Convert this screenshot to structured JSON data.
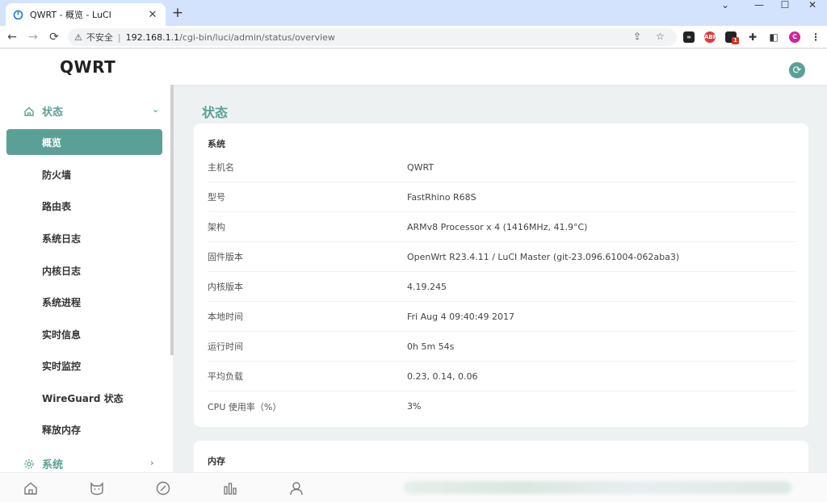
{
  "browser": {
    "tab_title": "QWRT - 概览 - LuCI",
    "insecure_label": "不安全",
    "url_host": "192.168.1.1",
    "url_path": "/cgi-bin/luci/admin/status/overview",
    "extension_badge": "1",
    "profile_initial": "C"
  },
  "app": {
    "brand": "QWRT",
    "accent_color": "#5ba096"
  },
  "sidebar": {
    "groups": [
      {
        "label": "状态",
        "icon": "home-icon",
        "expanded": true
      },
      {
        "label": "系统",
        "icon": "gear-icon",
        "expanded": false
      }
    ],
    "items": [
      {
        "label": "概览",
        "active": true
      },
      {
        "label": "防火墙"
      },
      {
        "label": "路由表"
      },
      {
        "label": "系统日志"
      },
      {
        "label": "内核日志"
      },
      {
        "label": "系统进程"
      },
      {
        "label": "实时信息"
      },
      {
        "label": "实时监控"
      },
      {
        "label": "WireGuard 状态"
      },
      {
        "label": "释放内存"
      }
    ]
  },
  "main": {
    "page_title": "状态",
    "system_card": {
      "title": "系统",
      "rows": [
        {
          "key": "主机名",
          "value": "QWRT"
        },
        {
          "key": "型号",
          "value": "FastRhino R68S"
        },
        {
          "key": "架构",
          "value": "ARMv8 Processor x 4 (1416MHz, 41.9°C)"
        },
        {
          "key": "固件版本",
          "value": "OpenWrt R23.4.11 / LuCI Master (git-23.096.61004-062aba3)"
        },
        {
          "key": "内核版本",
          "value": "4.19.245"
        },
        {
          "key": "本地时间",
          "value": "Fri Aug 4 09:40:49 2017"
        },
        {
          "key": "运行时间",
          "value": "0h 5m 54s"
        },
        {
          "key": "平均负载",
          "value": "0.23, 0.14, 0.06"
        },
        {
          "key": "CPU 使用率（%）",
          "value": "3%"
        }
      ]
    },
    "memory_card": {
      "title": "内存"
    }
  },
  "bottom_nav": [
    {
      "icon": "home-icon"
    },
    {
      "icon": "cat-icon"
    },
    {
      "icon": "compass-icon"
    },
    {
      "icon": "bar-chart-icon"
    },
    {
      "icon": "user-icon"
    }
  ]
}
